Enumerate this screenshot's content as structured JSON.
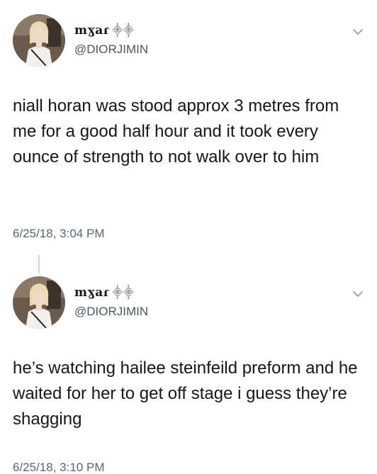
{
  "tweets": [
    {
      "display_name": "mɣaɾ",
      "display_name_decoration": "⸎⸎",
      "handle": "@DIORJIMIN",
      "text": "niall horan was stood approx 3 metres from me for a good half hour and it took every ounce of strength to not walk over to him",
      "timestamp": "6/25/18, 3:04 PM",
      "avatar_icon": "profile-photo",
      "menu_icon": "chevron-down-icon"
    },
    {
      "display_name": "mɣaɾ",
      "display_name_decoration": "⸎⸎",
      "handle": "@DIORJIMIN",
      "text": "he’s watching hailee steinfeild preform and he waited for her to get off stage i guess they’re shagging",
      "timestamp": "6/25/18, 3:10 PM",
      "avatar_icon": "profile-photo",
      "menu_icon": "chevron-down-icon"
    }
  ],
  "colors": {
    "text": "#14171a",
    "secondary_text": "#5b6670",
    "chevron": "#8899a6",
    "thread_line": "#ccd6dd",
    "background": "#ffffff"
  }
}
